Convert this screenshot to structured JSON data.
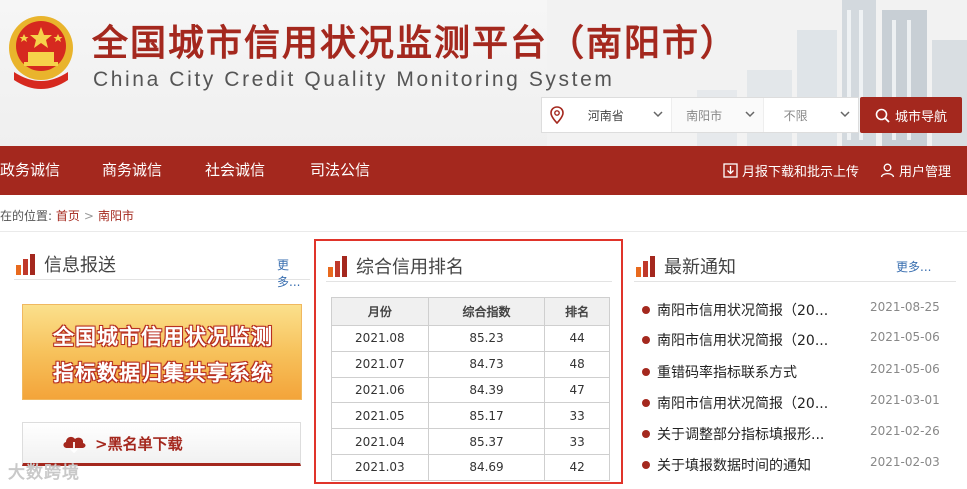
{
  "header": {
    "title": "全国城市信用状况监测平台（南阳市）",
    "subtitle": "China City Credit Quality Monitoring System",
    "province": "河南省",
    "city": "南阳市",
    "district": "不限",
    "city_nav_label": "城市导航"
  },
  "nav": {
    "items": [
      "政务诚信",
      "商务诚信",
      "社会诚信",
      "司法公信"
    ],
    "report_label": "月报下载和批示上传",
    "user_label": "用户管理"
  },
  "breadcrumb": {
    "prefix": "在的位置:",
    "home": "首页",
    "sep": ">",
    "current": "南阳市"
  },
  "info_panel": {
    "title": "信息报送",
    "more": "更多...",
    "banner_lines": [
      "全国城市信用状况监测",
      "指标数据归集共享系统"
    ],
    "blacklist_label": ">黑名单下载"
  },
  "ranking_panel": {
    "title": "综合信用排名",
    "columns": [
      "月份",
      "综合指数",
      "排名"
    ],
    "rows": [
      [
        "2021.08",
        "85.23",
        "44"
      ],
      [
        "2021.07",
        "84.73",
        "48"
      ],
      [
        "2021.06",
        "84.39",
        "47"
      ],
      [
        "2021.05",
        "85.17",
        "33"
      ],
      [
        "2021.04",
        "85.37",
        "33"
      ],
      [
        "2021.03",
        "84.69",
        "42"
      ]
    ]
  },
  "notice_panel": {
    "title": "最新通知",
    "more": "更多...",
    "items": [
      {
        "title": "南阳市信用状况简报（20...",
        "date": "2021-08-25"
      },
      {
        "title": "南阳市信用状况简报（20...",
        "date": "2021-05-06"
      },
      {
        "title": "重错码率指标联系方式",
        "date": "2021-05-06"
      },
      {
        "title": "南阳市信用状况简报（20...",
        "date": "2021-03-01"
      },
      {
        "title": "关于调整部分指标填报形...",
        "date": "2021-02-26"
      },
      {
        "title": "关于填报数据时间的通知",
        "date": "2021-02-03"
      }
    ]
  },
  "watermark": "大数跨境",
  "colors": {
    "brand": "#a4281e",
    "highlight_frame": "#e0342a",
    "link": "#3a6fb0"
  }
}
